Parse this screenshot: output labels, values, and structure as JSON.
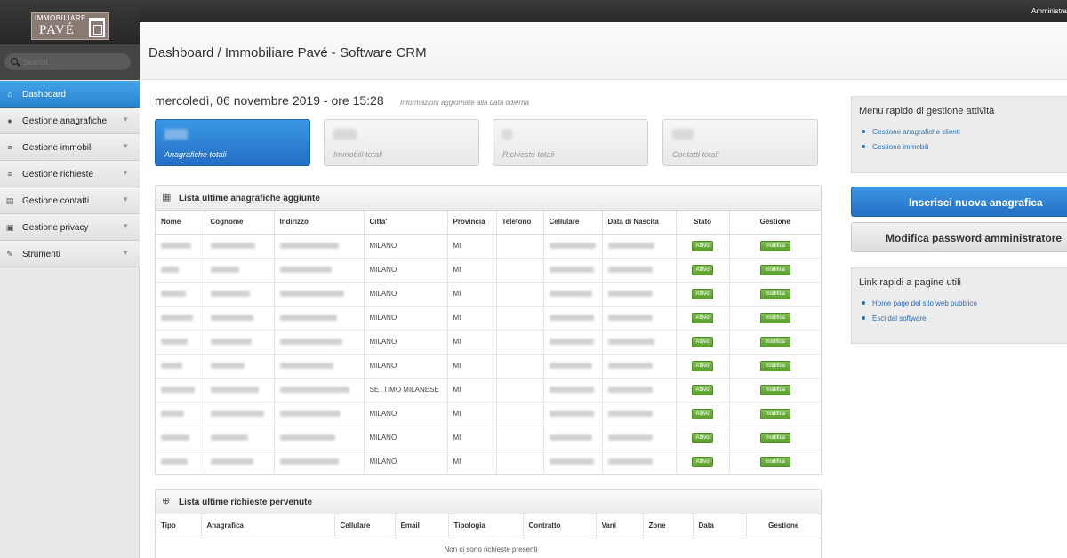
{
  "topbar": {
    "user": "Amministra"
  },
  "brand": {
    "line1": "IMMOBILIARE",
    "line2": "PAVÉ"
  },
  "search": {
    "placeholder": "Search..."
  },
  "nav": [
    {
      "label": "Dashboard",
      "icon": "home-icon",
      "glyph": "⌂",
      "active": true
    },
    {
      "label": "Gestione anagrafiche",
      "icon": "user-icon",
      "glyph": "●",
      "active": false
    },
    {
      "label": "Gestione immobili",
      "icon": "list-icon",
      "glyph": "≡",
      "active": false
    },
    {
      "label": "Gestione richieste",
      "icon": "list-icon",
      "glyph": "≡",
      "active": false
    },
    {
      "label": "Gestione contatti",
      "icon": "document-icon",
      "glyph": "▤",
      "active": false
    },
    {
      "label": "Gestione privacy",
      "icon": "lock-icon",
      "glyph": "▣",
      "active": false
    },
    {
      "label": "Strumenti",
      "icon": "wrench-icon",
      "glyph": "✎",
      "active": false
    }
  ],
  "page": {
    "title": "Dashboard / Immobiliare Pavé - Software CRM",
    "date": "mercoledì, 06 novembre 2019 - ore 15:28",
    "date_note": "Informazioni aggiornate alla data odierna"
  },
  "stats": [
    {
      "caption": "Anagrafiche totali",
      "primary": true
    },
    {
      "caption": "Immobili totali",
      "primary": false
    },
    {
      "caption": "Richieste totali",
      "primary": false
    },
    {
      "caption": "Contatti totali",
      "primary": false
    }
  ],
  "anagrafiche": {
    "title": "Lista ultime anagrafiche aggiunte",
    "headers": [
      "Nome",
      "Cognome",
      "Indirizzo",
      "Citta'",
      "Provincia",
      "Telefono",
      "Cellulare",
      "Data di Nascita",
      "Stato",
      "Gestione"
    ],
    "rows": [
      {
        "citta": "MILANO",
        "provincia": "MI",
        "stato": "Attivo",
        "gestione": "modifica"
      },
      {
        "citta": "MILANO",
        "provincia": "MI",
        "stato": "Attivo",
        "gestione": "modifica"
      },
      {
        "citta": "MILANO",
        "provincia": "MI",
        "stato": "Attivo",
        "gestione": "modifica"
      },
      {
        "citta": "MILANO",
        "provincia": "MI",
        "stato": "Attivo",
        "gestione": "modifica"
      },
      {
        "citta": "MILANO",
        "provincia": "MI",
        "stato": "Attivo",
        "gestione": "modifica"
      },
      {
        "citta": "MILANO",
        "provincia": "MI",
        "stato": "Attivo",
        "gestione": "modifica"
      },
      {
        "citta": "SETTIMO MILANESE",
        "provincia": "MI",
        "stato": "Attivo",
        "gestione": "modifica"
      },
      {
        "citta": "MILANO",
        "provincia": "MI",
        "stato": "Attivo",
        "gestione": "modifica"
      },
      {
        "citta": "MILANO",
        "provincia": "MI",
        "stato": "Attivo",
        "gestione": "modifica"
      },
      {
        "citta": "MILANO",
        "provincia": "MI",
        "stato": "Attivo",
        "gestione": "modifica"
      }
    ]
  },
  "richieste": {
    "title": "Lista ultime richieste pervenute",
    "headers": [
      "Tipo",
      "Anagrafica",
      "Cellulare",
      "Email",
      "Tipologia",
      "Contratto",
      "Vani",
      "Zone",
      "Data",
      "Gestione"
    ],
    "empty": "Non ci sono richieste presenti"
  },
  "quick_menu": {
    "title": "Menu rapido di gestione attività",
    "links": [
      "Gestione anagrafiche clienti",
      "Gestione immobili"
    ]
  },
  "buttons": {
    "new": "Inserisci nuova anagrafica",
    "password": "Modifica password amministratore"
  },
  "quick_links": {
    "title": "Link rapidi a pagine utili",
    "links": [
      "Home page del sito web pubblico",
      "Esci dal software"
    ]
  },
  "colors": {
    "accent": "#2a83cf",
    "success": "#5a9e2f"
  }
}
